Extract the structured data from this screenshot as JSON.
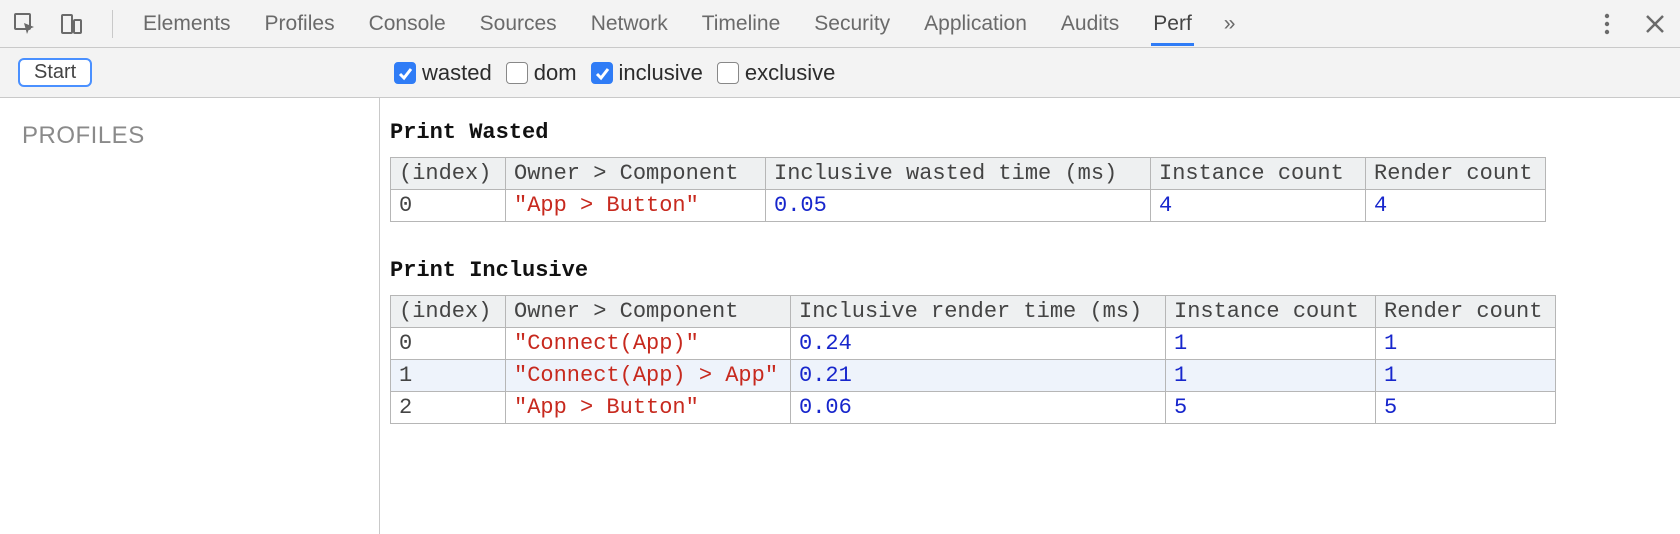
{
  "tabs": [
    "Elements",
    "Profiles",
    "Console",
    "Sources",
    "Network",
    "Timeline",
    "Security",
    "Application",
    "Audits",
    "Perf"
  ],
  "active_tab": "Perf",
  "overflow_glyph": "»",
  "start_button": "Start",
  "filters": {
    "wasted": {
      "label": "wasted",
      "checked": true
    },
    "dom": {
      "label": "dom",
      "checked": false
    },
    "inclusive": {
      "label": "inclusive",
      "checked": true
    },
    "exclusive": {
      "label": "exclusive",
      "checked": false
    }
  },
  "sidebar_title": "PROFILES",
  "wasted": {
    "title": "Print Wasted",
    "headers": [
      "(index)",
      "Owner > Component",
      "Inclusive wasted time (ms)",
      "Instance count",
      "Render count"
    ],
    "rows": [
      {
        "index": "0",
        "component": "\"App > Button\"",
        "time": "0.05",
        "instances": "4",
        "renders": "4"
      }
    ]
  },
  "inclusive": {
    "title": "Print Inclusive",
    "headers": [
      "(index)",
      "Owner > Component",
      "Inclusive render time (ms)",
      "Instance count",
      "Render count"
    ],
    "rows": [
      {
        "index": "0",
        "component": "\"Connect(App)\"",
        "time": "0.24",
        "instances": "1",
        "renders": "1"
      },
      {
        "index": "1",
        "component": "\"Connect(App) > App\"",
        "time": "0.21",
        "instances": "1",
        "renders": "1"
      },
      {
        "index": "2",
        "component": "\"App > Button\"",
        "time": "0.06",
        "instances": "5",
        "renders": "5"
      }
    ]
  }
}
